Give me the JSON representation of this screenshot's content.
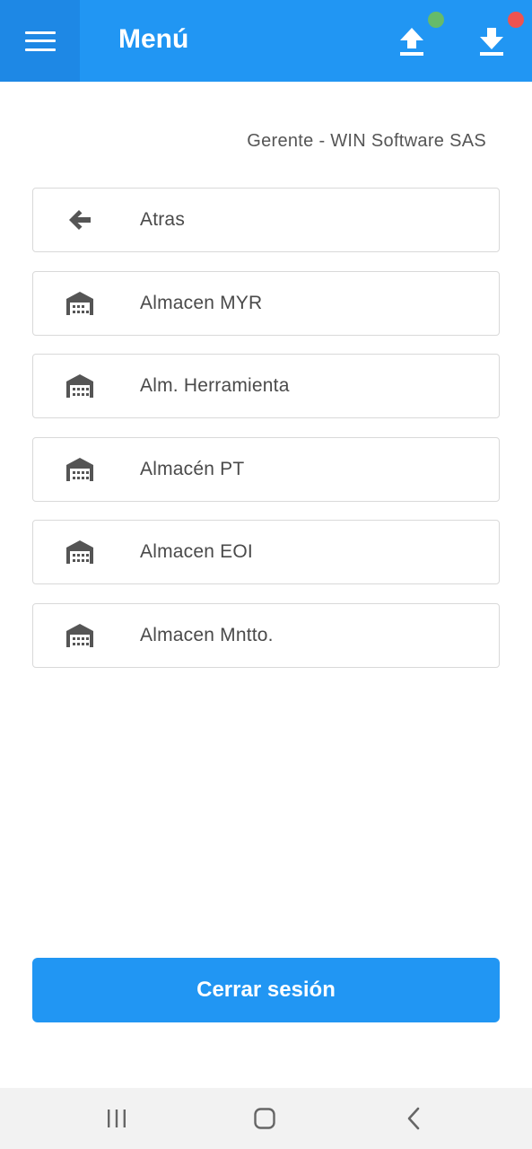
{
  "appbar": {
    "title": "Menú",
    "menu_icon": "hamburger-icon",
    "upload_icon": "upload-icon",
    "download_icon": "download-icon",
    "upload_status_color": "#66BB6A",
    "download_status_color": "#EF5350",
    "background_color": "#2196F3"
  },
  "user": {
    "label": "Gerente - WIN Software SAS"
  },
  "menu": {
    "items": [
      {
        "label": "Atras",
        "icon": "back-arrow-icon"
      },
      {
        "label": "Almacen MYR",
        "icon": "warehouse-icon"
      },
      {
        "label": "Alm. Herramienta",
        "icon": "warehouse-icon"
      },
      {
        "label": "Almacén PT",
        "icon": "warehouse-icon"
      },
      {
        "label": "Almacen EOI",
        "icon": "warehouse-icon"
      },
      {
        "label": "Almacen Mntto.",
        "icon": "warehouse-icon"
      }
    ]
  },
  "logout": {
    "label": "Cerrar sesión"
  },
  "navbar": {
    "recent_icon": "recent-apps-icon",
    "home_icon": "home-icon",
    "back_icon": "back-icon"
  }
}
